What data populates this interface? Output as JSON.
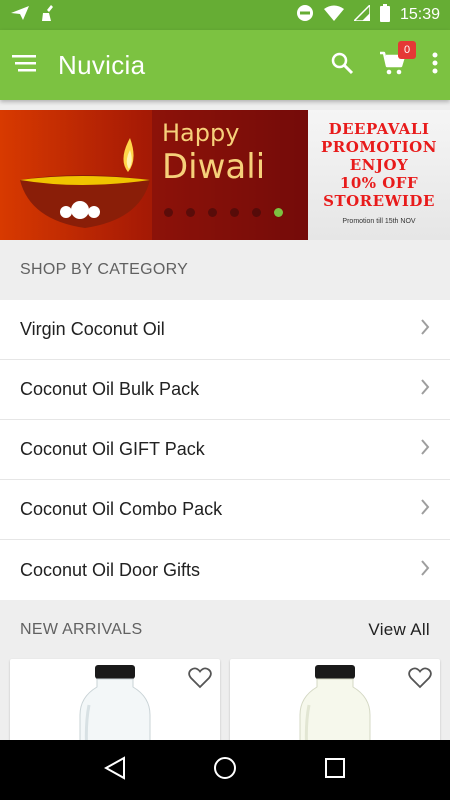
{
  "status_bar": {
    "time": "15:39"
  },
  "app_bar": {
    "title": "Nuvicia",
    "cart_count": "0"
  },
  "banner": {
    "happy": "Happy",
    "diwali": "Diwali",
    "promo_lines": [
      "DEEPAVALI",
      "PROMOTION",
      "ENJOY",
      "10% OFF",
      "STOREWIDE"
    ],
    "promo_note": "Promotion till 15th NOV",
    "slide_count": 6,
    "active_slide": 6
  },
  "shop_by_category": {
    "heading": "SHOP BY CATEGORY",
    "items": [
      {
        "label": "Virgin Coconut Oil"
      },
      {
        "label": "Coconut Oil Bulk Pack"
      },
      {
        "label": "Coconut Oil GIFT Pack"
      },
      {
        "label": "Coconut Oil Combo Pack"
      },
      {
        "label": "Coconut Oil Door Gifts"
      }
    ]
  },
  "new_arrivals": {
    "heading": "NEW ARRIVALS",
    "view_all": "View All"
  },
  "colors": {
    "primary": "#7cc241",
    "status": "#66ad34",
    "badge": "#e53935",
    "promo": "#e81b1b"
  },
  "icons": [
    "menu-icon",
    "search-icon",
    "cart-icon",
    "overflow-menu-icon",
    "heart-icon",
    "chevron-right-icon",
    "back-icon",
    "home-icon",
    "recents-icon"
  ]
}
